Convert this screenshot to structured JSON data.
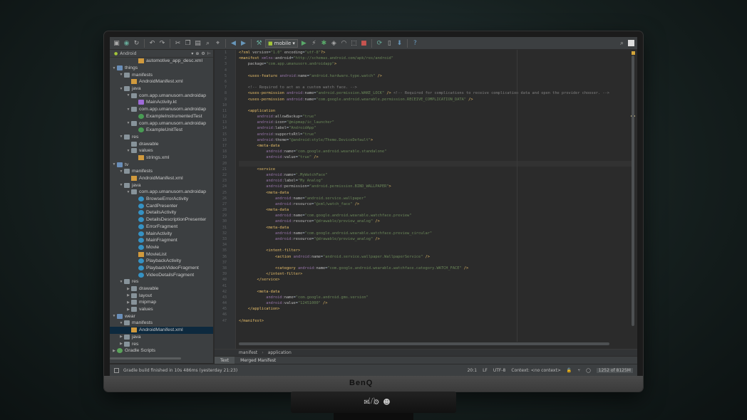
{
  "monitor": {
    "brand": "BenQ"
  },
  "toolbar": {
    "run_config": "mobile"
  },
  "project": {
    "view_mode": "Android",
    "tree": [
      {
        "indent": 3,
        "arrow": "",
        "icon": "xml",
        "label": "automotive_app_desc.xml"
      },
      {
        "indent": 0,
        "arrow": "▼",
        "icon": "module",
        "label": "things"
      },
      {
        "indent": 1,
        "arrow": "▼",
        "icon": "folder",
        "label": "manifests"
      },
      {
        "indent": 2,
        "arrow": "",
        "icon": "xml",
        "label": "AndroidManifest.xml"
      },
      {
        "indent": 1,
        "arrow": "▼",
        "icon": "folder",
        "label": "java"
      },
      {
        "indent": 2,
        "arrow": "▼",
        "icon": "folder",
        "label": "com.app.umanusorn.androidap"
      },
      {
        "indent": 3,
        "arrow": "",
        "icon": "kt",
        "label": "MainActivity.kt"
      },
      {
        "indent": 2,
        "arrow": "▼",
        "icon": "folder",
        "label": "com.app.umanusorn.androidap"
      },
      {
        "indent": 3,
        "arrow": "",
        "icon": "test",
        "label": "ExampleInstrumentedTest"
      },
      {
        "indent": 2,
        "arrow": "▼",
        "icon": "folder",
        "label": "com.app.umanusorn.androidap"
      },
      {
        "indent": 3,
        "arrow": "",
        "icon": "test",
        "label": "ExampleUnitTest"
      },
      {
        "indent": 1,
        "arrow": "▼",
        "icon": "folder",
        "label": "res"
      },
      {
        "indent": 2,
        "arrow": "",
        "icon": "folder",
        "label": "drawable"
      },
      {
        "indent": 2,
        "arrow": "▼",
        "icon": "folder",
        "label": "values"
      },
      {
        "indent": 3,
        "arrow": "",
        "icon": "xml",
        "label": "strings.xml"
      },
      {
        "indent": 0,
        "arrow": "▼",
        "icon": "module",
        "label": "tv"
      },
      {
        "indent": 1,
        "arrow": "▼",
        "icon": "folder",
        "label": "manifests"
      },
      {
        "indent": 2,
        "arrow": "",
        "icon": "xml",
        "label": "AndroidManifest.xml"
      },
      {
        "indent": 1,
        "arrow": "▼",
        "icon": "folder",
        "label": "java"
      },
      {
        "indent": 2,
        "arrow": "▼",
        "icon": "folder",
        "label": "com.app.umanusorn.androidap"
      },
      {
        "indent": 3,
        "arrow": "",
        "icon": "class",
        "label": "BrowseErrorActivity"
      },
      {
        "indent": 3,
        "arrow": "",
        "icon": "class",
        "label": "CardPresenter"
      },
      {
        "indent": 3,
        "arrow": "",
        "icon": "class",
        "label": "DetailsActivity"
      },
      {
        "indent": 3,
        "arrow": "",
        "icon": "class",
        "label": "DetailsDescriptionPresenter"
      },
      {
        "indent": 3,
        "arrow": "",
        "icon": "class",
        "label": "ErrorFragment"
      },
      {
        "indent": 3,
        "arrow": "",
        "icon": "class",
        "label": "MainActivity"
      },
      {
        "indent": 3,
        "arrow": "",
        "icon": "class",
        "label": "MainFragment"
      },
      {
        "indent": 3,
        "arrow": "",
        "icon": "class",
        "label": "Movie"
      },
      {
        "indent": 3,
        "arrow": "",
        "icon": "xml",
        "label": "MovieList"
      },
      {
        "indent": 3,
        "arrow": "",
        "icon": "class",
        "label": "PlaybackActivity"
      },
      {
        "indent": 3,
        "arrow": "",
        "icon": "class",
        "label": "PlaybackVideoFragment"
      },
      {
        "indent": 3,
        "arrow": "",
        "icon": "class",
        "label": "VideoDetailsFragment"
      },
      {
        "indent": 1,
        "arrow": "▼",
        "icon": "folder",
        "label": "res"
      },
      {
        "indent": 2,
        "arrow": "▶",
        "icon": "folder",
        "label": "drawable"
      },
      {
        "indent": 2,
        "arrow": "▶",
        "icon": "folder",
        "label": "layout"
      },
      {
        "indent": 2,
        "arrow": "▶",
        "icon": "folder",
        "label": "mipmap"
      },
      {
        "indent": 2,
        "arrow": "▶",
        "icon": "folder",
        "label": "values"
      },
      {
        "indent": 0,
        "arrow": "▼",
        "icon": "module",
        "label": "wear"
      },
      {
        "indent": 1,
        "arrow": "▼",
        "icon": "folder",
        "label": "manifests"
      },
      {
        "indent": 2,
        "arrow": "",
        "icon": "xml",
        "label": "AndroidManifest.xml",
        "selected": true
      },
      {
        "indent": 1,
        "arrow": "▶",
        "icon": "folder",
        "label": "java"
      },
      {
        "indent": 1,
        "arrow": "▶",
        "icon": "folder",
        "label": "res"
      },
      {
        "indent": 0,
        "arrow": "▶",
        "icon": "gradle",
        "label": "Gradle Scripts"
      }
    ]
  },
  "editor": {
    "lines": [
      "<?xml version=\"1.0\" encoding=\"utf-8\"?>",
      "<manifest xmlns:android=\"http://schemas.android.com/apk/res/android\"",
      "    package=\"com.app.umanusorn.androidapp\">",
      "",
      "    <uses-feature android:name=\"android.hardware.type.watch\" />",
      "",
      "    <!-- Required to act as a custom watch face. -->",
      "    <uses-permission android:name=\"android.permission.WAKE_LOCK\" /> <!-- Required for complications to receive complication data and open the provider chooser. -->",
      "    <uses-permission android:name=\"com.google.android.wearable.permission.RECEIVE_COMPLICATION_DATA\" />",
      "",
      "    <application",
      "        android:allowBackup=\"true\"",
      "        android:icon=\"@mipmap/ic_launcher\"",
      "        android:label=\"AndroidApp\"",
      "        android:supportsRtl=\"true\"",
      "        android:theme=\"@android:style/Theme.DeviceDefault\">",
      "        <meta-data",
      "            android:name=\"com.google.android.wearable.standalone\"",
      "            android:value=\"true\" />",
      "",
      "        <service",
      "            android:name=\".MyWatchFace\"",
      "            android:label=\"My Analog\"",
      "            android:permission=\"android.permission.BIND_WALLPAPER\">",
      "            <meta-data",
      "                android:name=\"android.service.wallpaper\"",
      "                android:resource=\"@xml/watch_face\" />",
      "            <meta-data",
      "                android:name=\"com.google.android.wearable.watchface.preview\"",
      "                android:resource=\"@drawable/preview_analog\" />",
      "            <meta-data",
      "                android:name=\"com.google.android.wearable.watchface.preview_circular\"",
      "                android:resource=\"@drawable/preview_analog\" />",
      "",
      "            <intent-filter>",
      "                <action android:name=\"android.service.wallpaper.WallpaperService\" />",
      "",
      "                <category android:name=\"com.google.android.wearable.watchface.category.WATCH_FACE\" />",
      "            </intent-filter>",
      "        </service>",
      "",
      "        <meta-data",
      "            android:name=\"com.google.android.gms.version\"",
      "            android:value=\"12451000\" />",
      "    </application>",
      "",
      "</manifest>"
    ],
    "current_line": 20
  },
  "breadcrumb": [
    "manifest",
    "application"
  ],
  "editor_tabs": [
    "Text",
    "Merged Manifest"
  ],
  "status": {
    "message": "Gradle build finished in 10s 486ms (yesterday 21:23)",
    "position": "20:1",
    "line_sep": "LF",
    "encoding": "UTF-8",
    "context": "Context: <no context>",
    "memory": "1252 of 8125M"
  },
  "colors": {
    "ide_bg": "#2b2b2b",
    "panel_bg": "#3c3f41",
    "xml_tag": "#e8bf6a",
    "xml_value": "#6a8759",
    "comment": "#808080"
  }
}
